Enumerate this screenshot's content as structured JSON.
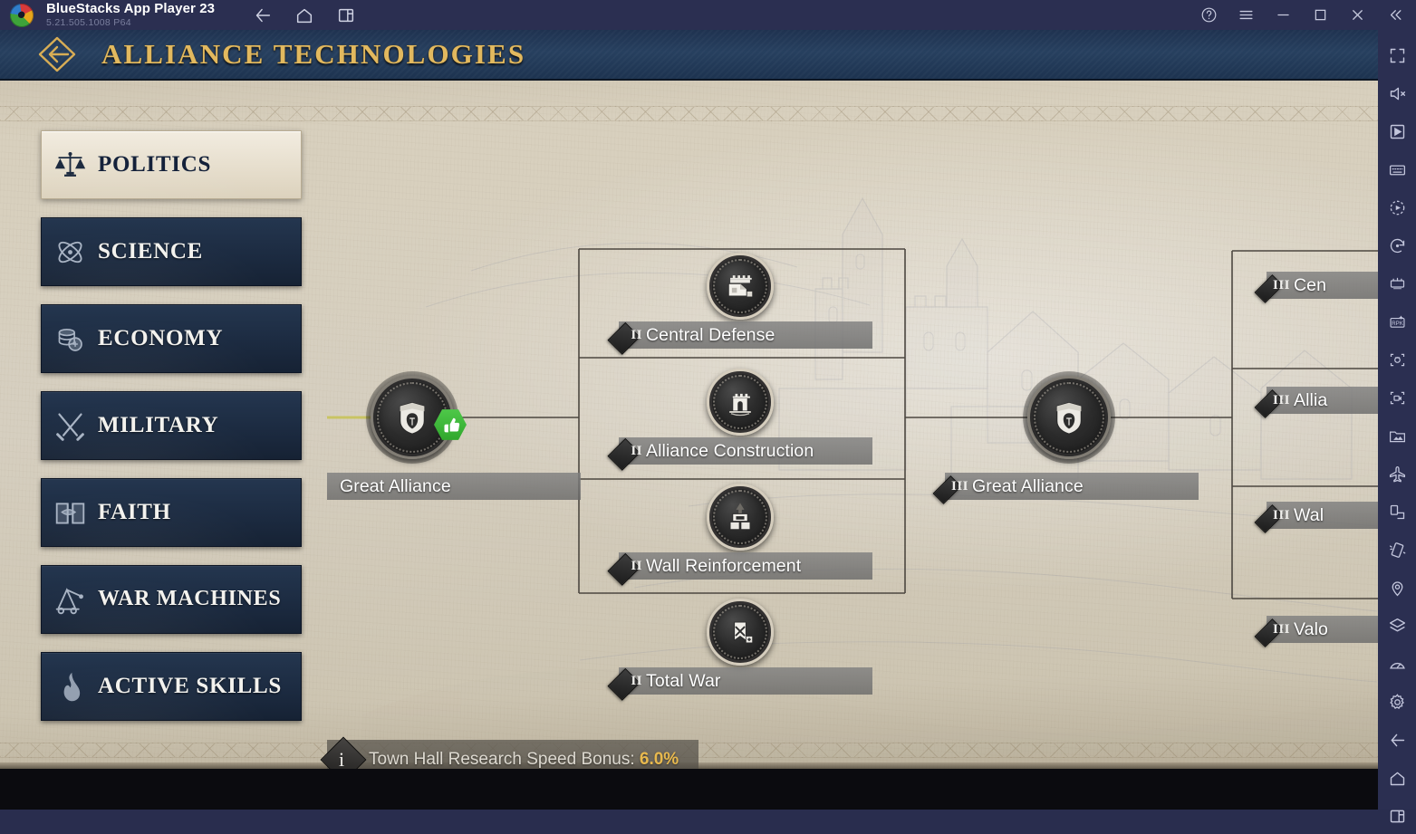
{
  "emulator": {
    "app_name": "BlueStacks App Player 23",
    "version": "5.21.505.1008  P64",
    "logo_icon": "bluestacks-logo",
    "nav": [
      {
        "name": "back-icon",
        "label": "Back"
      },
      {
        "name": "home-icon",
        "label": "Home"
      },
      {
        "name": "multi-instance-icon",
        "label": "Multi-instance"
      }
    ],
    "window_controls": [
      {
        "name": "help-icon",
        "label": "Help"
      },
      {
        "name": "menu-icon",
        "label": "Menu"
      },
      {
        "name": "minimize-icon",
        "label": "Minimize"
      },
      {
        "name": "maximize-icon",
        "label": "Maximize"
      },
      {
        "name": "close-icon",
        "label": "Close"
      },
      {
        "name": "collapse-rail-icon",
        "label": "Collapse sidebar"
      }
    ],
    "rail": [
      {
        "name": "fullscreen-icon",
        "label": "Fullscreen"
      },
      {
        "name": "mute-icon",
        "label": "Mute"
      },
      {
        "name": "game-controls-icon",
        "label": "Game controls"
      },
      {
        "name": "keyboard-icon",
        "label": "Keymapping"
      },
      {
        "name": "macro-play-icon",
        "label": "Macro recorder"
      },
      {
        "name": "sync-icon",
        "label": "Sync operations"
      },
      {
        "name": "eco-mode-icon",
        "label": "Eco mode"
      },
      {
        "name": "rpk-icon",
        "label": "RPK"
      },
      {
        "name": "screenshot-icon",
        "label": "Screenshot"
      },
      {
        "name": "record-screen-icon",
        "label": "Record screen"
      },
      {
        "name": "media-manager-icon",
        "label": "Media manager"
      },
      {
        "name": "airplane-icon",
        "label": "Airplane mode"
      },
      {
        "name": "rotate-layout-icon",
        "label": "Rotate"
      },
      {
        "name": "shake-icon",
        "label": "Shake"
      },
      {
        "name": "location-icon",
        "label": "Location"
      },
      {
        "name": "layers-icon",
        "label": "Layers"
      },
      {
        "name": "performance-icon",
        "label": "Performance"
      },
      {
        "name": "settings-icon",
        "label": "Settings"
      },
      {
        "name": "back-icon",
        "label": "Back"
      },
      {
        "name": "home-icon",
        "label": "Home"
      },
      {
        "name": "recent-apps-icon",
        "label": "Recent apps"
      }
    ]
  },
  "header": {
    "back_icon": "back-arrow-hex-icon",
    "title": "ALLIANCE TECHNOLOGIES",
    "title_color": "#e2b95f",
    "bar_color": "#27405f"
  },
  "sidebar": {
    "items": [
      {
        "label": "POLITICS",
        "icon": "scales-icon",
        "active": true
      },
      {
        "label": "SCIENCE",
        "icon": "atom-icon",
        "active": false
      },
      {
        "label": "ECONOMY",
        "icon": "coins-icon",
        "active": false
      },
      {
        "label": "MILITARY",
        "icon": "swords-icon",
        "active": false
      },
      {
        "label": "FAITH",
        "icon": "book-icon",
        "active": false
      },
      {
        "label": "WAR MACHINES",
        "icon": "catapult-icon",
        "active": false
      },
      {
        "label": "ACTIVE SKILLS",
        "icon": "flame-icon",
        "active": false
      }
    ]
  },
  "tree": {
    "root": {
      "name": "Great Alliance",
      "tier": "",
      "icon": "alliance-crest-icon",
      "status_badge": "thumbs-up-icon",
      "status_color": "#3fb23a",
      "researched": true
    },
    "tier2_nodes": [
      {
        "name": "Central Defense",
        "tier": "II",
        "icon": "fortress-gate-icon"
      },
      {
        "name": "Alliance Construction",
        "tier": "II",
        "icon": "castle-icon"
      },
      {
        "name": "Wall Reinforcement",
        "tier": "II",
        "icon": "wall-tower-icon"
      },
      {
        "name": "Total War",
        "tier": "II",
        "icon": "banner-swords-icon"
      }
    ],
    "tier3_hub": {
      "name": "Great Alliance",
      "tier": "III",
      "icon": "alliance-crest-icon"
    },
    "tier3_nodes": [
      {
        "name": "Cen",
        "tier": "III"
      },
      {
        "name": "Allia",
        "tier": "III"
      },
      {
        "name": "Wal",
        "tier": "III"
      },
      {
        "name": "Valo",
        "tier": "III"
      }
    ]
  },
  "info_bar": {
    "icon": "info-icon",
    "text": "Town Hall Research Speed Bonus: ",
    "value": "6.0%",
    "value_color": "#e8b94e"
  }
}
